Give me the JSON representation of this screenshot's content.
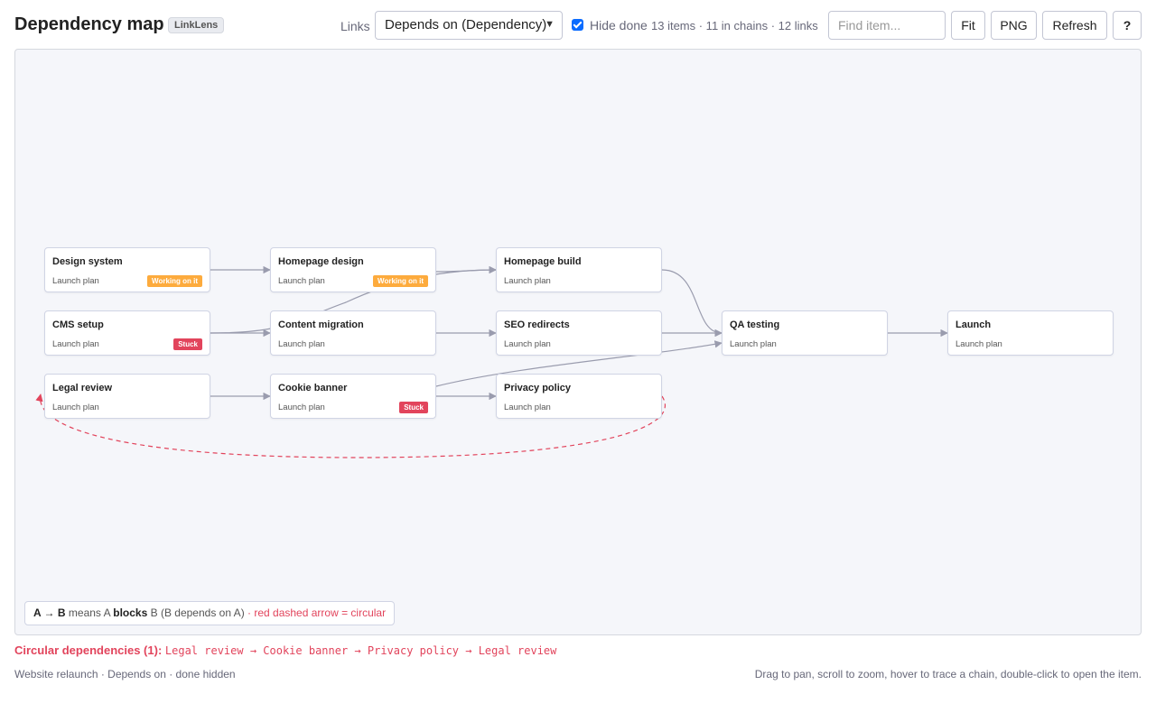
{
  "header": {
    "title": "Dependency map",
    "app_badge": "LinkLens",
    "links_label": "Links",
    "links_select_value": "Depends on (Dependency)",
    "hide_done_label": "Hide done",
    "hide_done_checked": true,
    "stats": "13 items · 11 in chains · 12 links",
    "find_placeholder": "Find item...",
    "fit_label": "Fit",
    "png_label": "PNG",
    "refresh_label": "Refresh",
    "help_label": "?"
  },
  "graph": {
    "nodes": [
      {
        "id": "design-system",
        "name": "Design system",
        "board": "Launch plan",
        "status": "Working on it",
        "status_color": "#fdab3d"
      },
      {
        "id": "homepage-design",
        "name": "Homepage design",
        "board": "Launch plan",
        "status": "Working on it",
        "status_color": "#fdab3d"
      },
      {
        "id": "homepage-build",
        "name": "Homepage build",
        "board": "Launch plan",
        "status": "",
        "status_color": ""
      },
      {
        "id": "cms-setup",
        "name": "CMS setup",
        "board": "Launch plan",
        "status": "Stuck",
        "status_color": "#e2445c"
      },
      {
        "id": "content-migration",
        "name": "Content migration",
        "board": "Launch plan",
        "status": "",
        "status_color": ""
      },
      {
        "id": "seo-redirects",
        "name": "SEO redirects",
        "board": "Launch plan",
        "status": "",
        "status_color": ""
      },
      {
        "id": "qa-testing",
        "name": "QA testing",
        "board": "Launch plan",
        "status": "",
        "status_color": ""
      },
      {
        "id": "launch",
        "name": "Launch",
        "board": "Launch plan",
        "status": "",
        "status_color": ""
      },
      {
        "id": "legal-review",
        "name": "Legal review",
        "board": "Launch plan",
        "status": "",
        "status_color": ""
      },
      {
        "id": "cookie-banner",
        "name": "Cookie banner",
        "board": "Launch plan",
        "status": "Stuck",
        "status_color": "#e2445c"
      },
      {
        "id": "privacy-policy",
        "name": "Privacy policy",
        "board": "Launch plan",
        "status": "",
        "status_color": ""
      }
    ],
    "edge_color": "#9a9cae",
    "circular_color": "#e2445c"
  },
  "legend": {
    "a_arrow_b": "A → B",
    "means_a": " means A ",
    "blocks": "blocks",
    "b_depends": " B (B depends on A)",
    "circular_note": " · red dashed arrow = circular"
  },
  "circular": {
    "label": "Circular dependencies (1):",
    "chain": "Legal review → Cookie banner → Privacy policy → Legal review"
  },
  "footer": {
    "left": "Website relaunch · Depends on · done hidden",
    "right": "Drag to pan, scroll to zoom, hover to trace a chain, double-click to open the item."
  }
}
